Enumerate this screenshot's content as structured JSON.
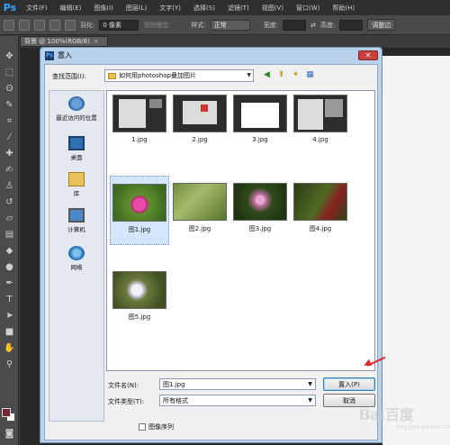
{
  "menubar": {
    "logo": "Ps",
    "items": [
      "文件(F)",
      "编辑(E)",
      "图像(I)",
      "图层(L)",
      "文字(Y)",
      "选择(S)",
      "滤镜(T)",
      "视图(V)",
      "窗口(W)",
      "帮助(H)"
    ]
  },
  "optbar": {
    "feather_label": "羽化:",
    "feather_value": "0 像素",
    "antialias_label": "消除锯齿",
    "style_label": "样式:",
    "style_value": "正常",
    "width_label": "宽度:",
    "height_label": "高度:",
    "refine_label": "调整边"
  },
  "doc_tab": {
    "label": "背景 @ 100%(RGB/8)",
    "close": "×"
  },
  "dialog": {
    "title": "置入",
    "close": "✕",
    "lookin_label": "查找范围(I):",
    "lookin_value": "如何用photoshop叠加图片",
    "places": [
      {
        "label": "最近访问的位置",
        "icon": "recent-places-icon"
      },
      {
        "label": "桌面",
        "icon": "desktop-icon"
      },
      {
        "label": "库",
        "icon": "libraries-icon"
      },
      {
        "label": "计算机",
        "icon": "computer-icon"
      },
      {
        "label": "网络",
        "icon": "network-icon"
      }
    ],
    "files": [
      {
        "name": "1.jpg",
        "kind": "screenshot"
      },
      {
        "name": "2.jpg",
        "kind": "screenshot"
      },
      {
        "name": "3.jpg",
        "kind": "screenshot"
      },
      {
        "name": "4.jpg",
        "kind": "screenshot"
      },
      {
        "name": "图1.jpg",
        "kind": "flower",
        "selected": true
      },
      {
        "name": "图2.jpg",
        "kind": "flower"
      },
      {
        "name": "图3.jpg",
        "kind": "flower"
      },
      {
        "name": "图4.jpg",
        "kind": "flower"
      },
      {
        "name": "图5.jpg",
        "kind": "flower"
      }
    ],
    "filename_label": "文件名(N):",
    "filename_value": "图1.jpg",
    "filetype_label": "文件类型(T):",
    "filetype_value": "所有格式",
    "place_button": "置入(P)",
    "cancel_button": "取消",
    "sequence_label": "图像序列"
  },
  "colors": {
    "foreground": "#7a2631",
    "background": "#ffffff",
    "accent_arrow": "#e0262b"
  },
  "watermark": {
    "text": "Bai百度",
    "sub": "jingyan.baidu.com"
  }
}
